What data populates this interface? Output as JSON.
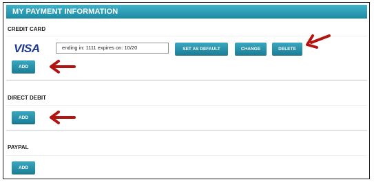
{
  "header": {
    "title": "MY PAYMENT INFORMATION"
  },
  "credit_card": {
    "title": "CREDIT CARD",
    "brand": "VISA",
    "card_summary": "ending in: 1111 expires on: 10/20",
    "set_default_label": "SET AS DEFAULT",
    "change_label": "CHANGE",
    "delete_label": "DELETE",
    "add_label": "ADD"
  },
  "direct_debit": {
    "title": "DIRECT DEBIT",
    "add_label": "ADD"
  },
  "paypal": {
    "title": "PAYPAL",
    "add_label": "ADD"
  },
  "colors": {
    "accent": "#1d8aa3",
    "annotation_arrow": "#b3140f",
    "visa": "#1f3a8f"
  },
  "annotations": [
    "arrow-to-delete",
    "arrow-to-credit-card-add",
    "arrow-to-direct-debit-add"
  ]
}
